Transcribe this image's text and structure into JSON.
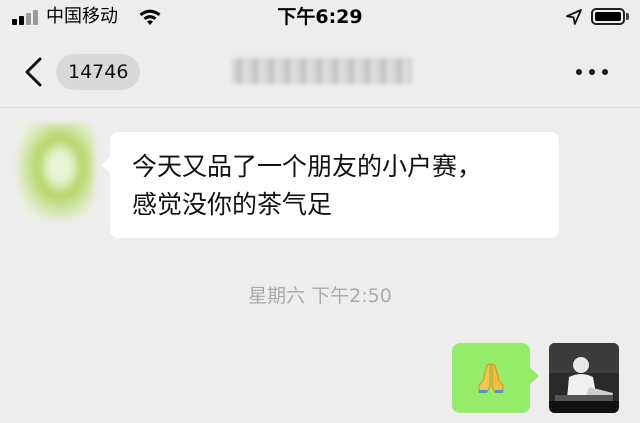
{
  "status_bar": {
    "carrier": "中国移动",
    "time": "下午6:29",
    "icons": [
      "signal-icon",
      "wifi-icon",
      "location-arrow-icon",
      "battery-icon"
    ]
  },
  "nav": {
    "back_icon": "chevron-left-icon",
    "unread_count": "14746",
    "more_icon": "more-horizontal-icon"
  },
  "messages": [
    {
      "side": "left",
      "lines": [
        "今天又品了一个朋友的小户赛，",
        "感觉没你的茶气足"
      ]
    },
    {
      "side": "right",
      "emoji": "🙏",
      "emoji_name": "folded-hands-icon"
    }
  ],
  "timestamp": "星期六 下午2:50",
  "colors": {
    "background": "#ededed",
    "incoming_bubble": "#ffffff",
    "outgoing_bubble": "#95ec69",
    "timestamp_text": "#ababab"
  }
}
